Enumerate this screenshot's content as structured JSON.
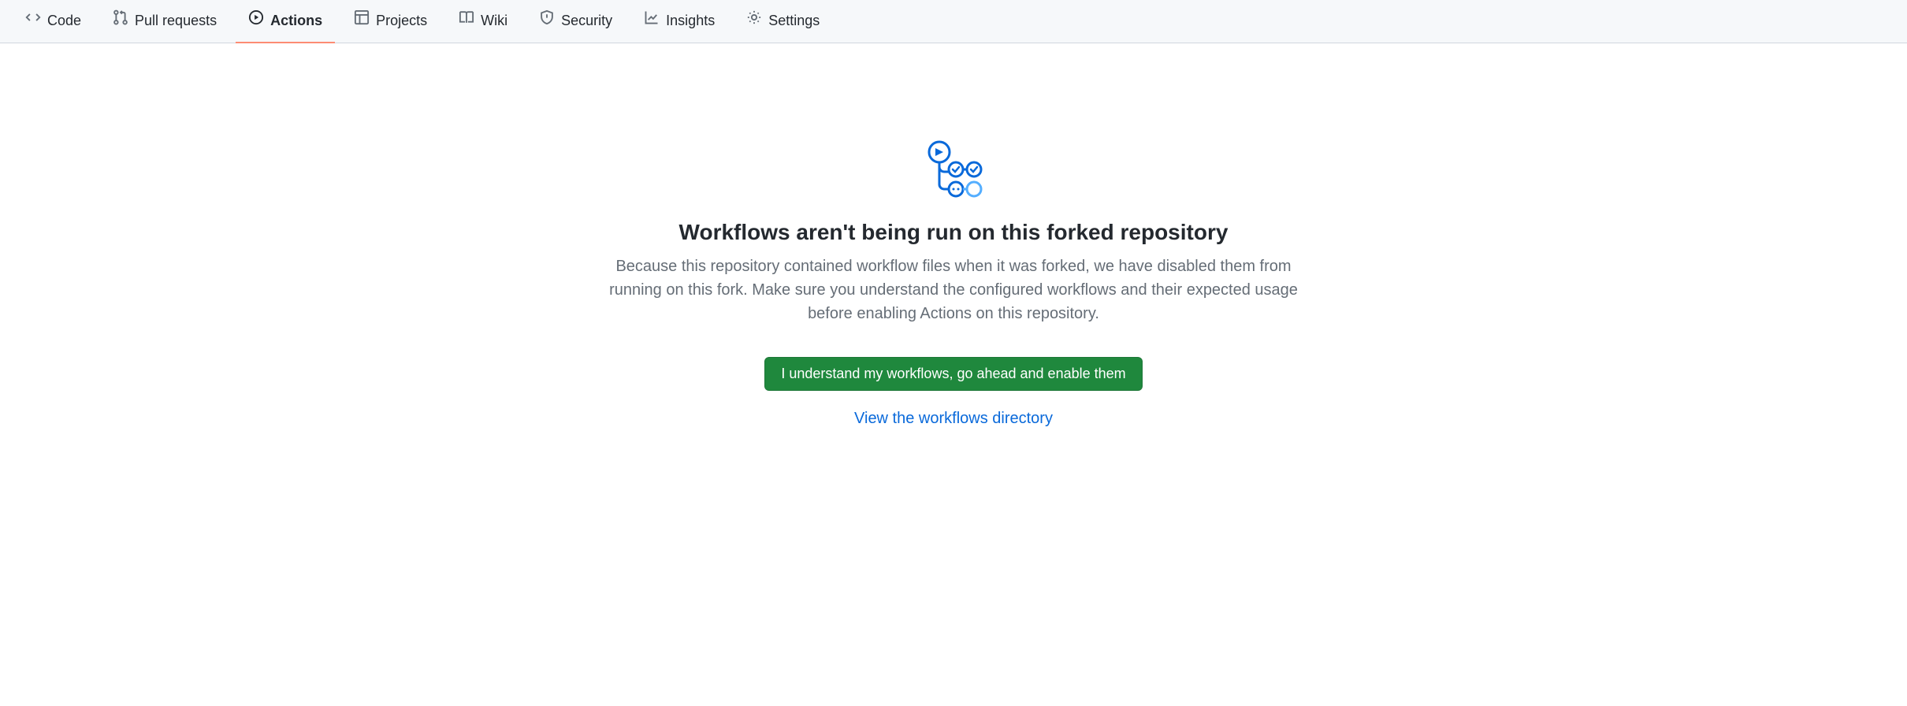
{
  "nav": {
    "code": "Code",
    "pull_requests": "Pull requests",
    "actions": "Actions",
    "projects": "Projects",
    "wiki": "Wiki",
    "security": "Security",
    "insights": "Insights",
    "settings": "Settings"
  },
  "blankslate": {
    "heading": "Workflows aren't being run on this forked repository",
    "text": "Because this repository contained workflow files when it was forked, we have disabled them from running on this fork. Make sure you understand the configured workflows and their expected usage before enabling Actions on this repository.",
    "enable_button": "I understand my workflows, go ahead and enable them",
    "view_link": "View the workflows directory"
  }
}
